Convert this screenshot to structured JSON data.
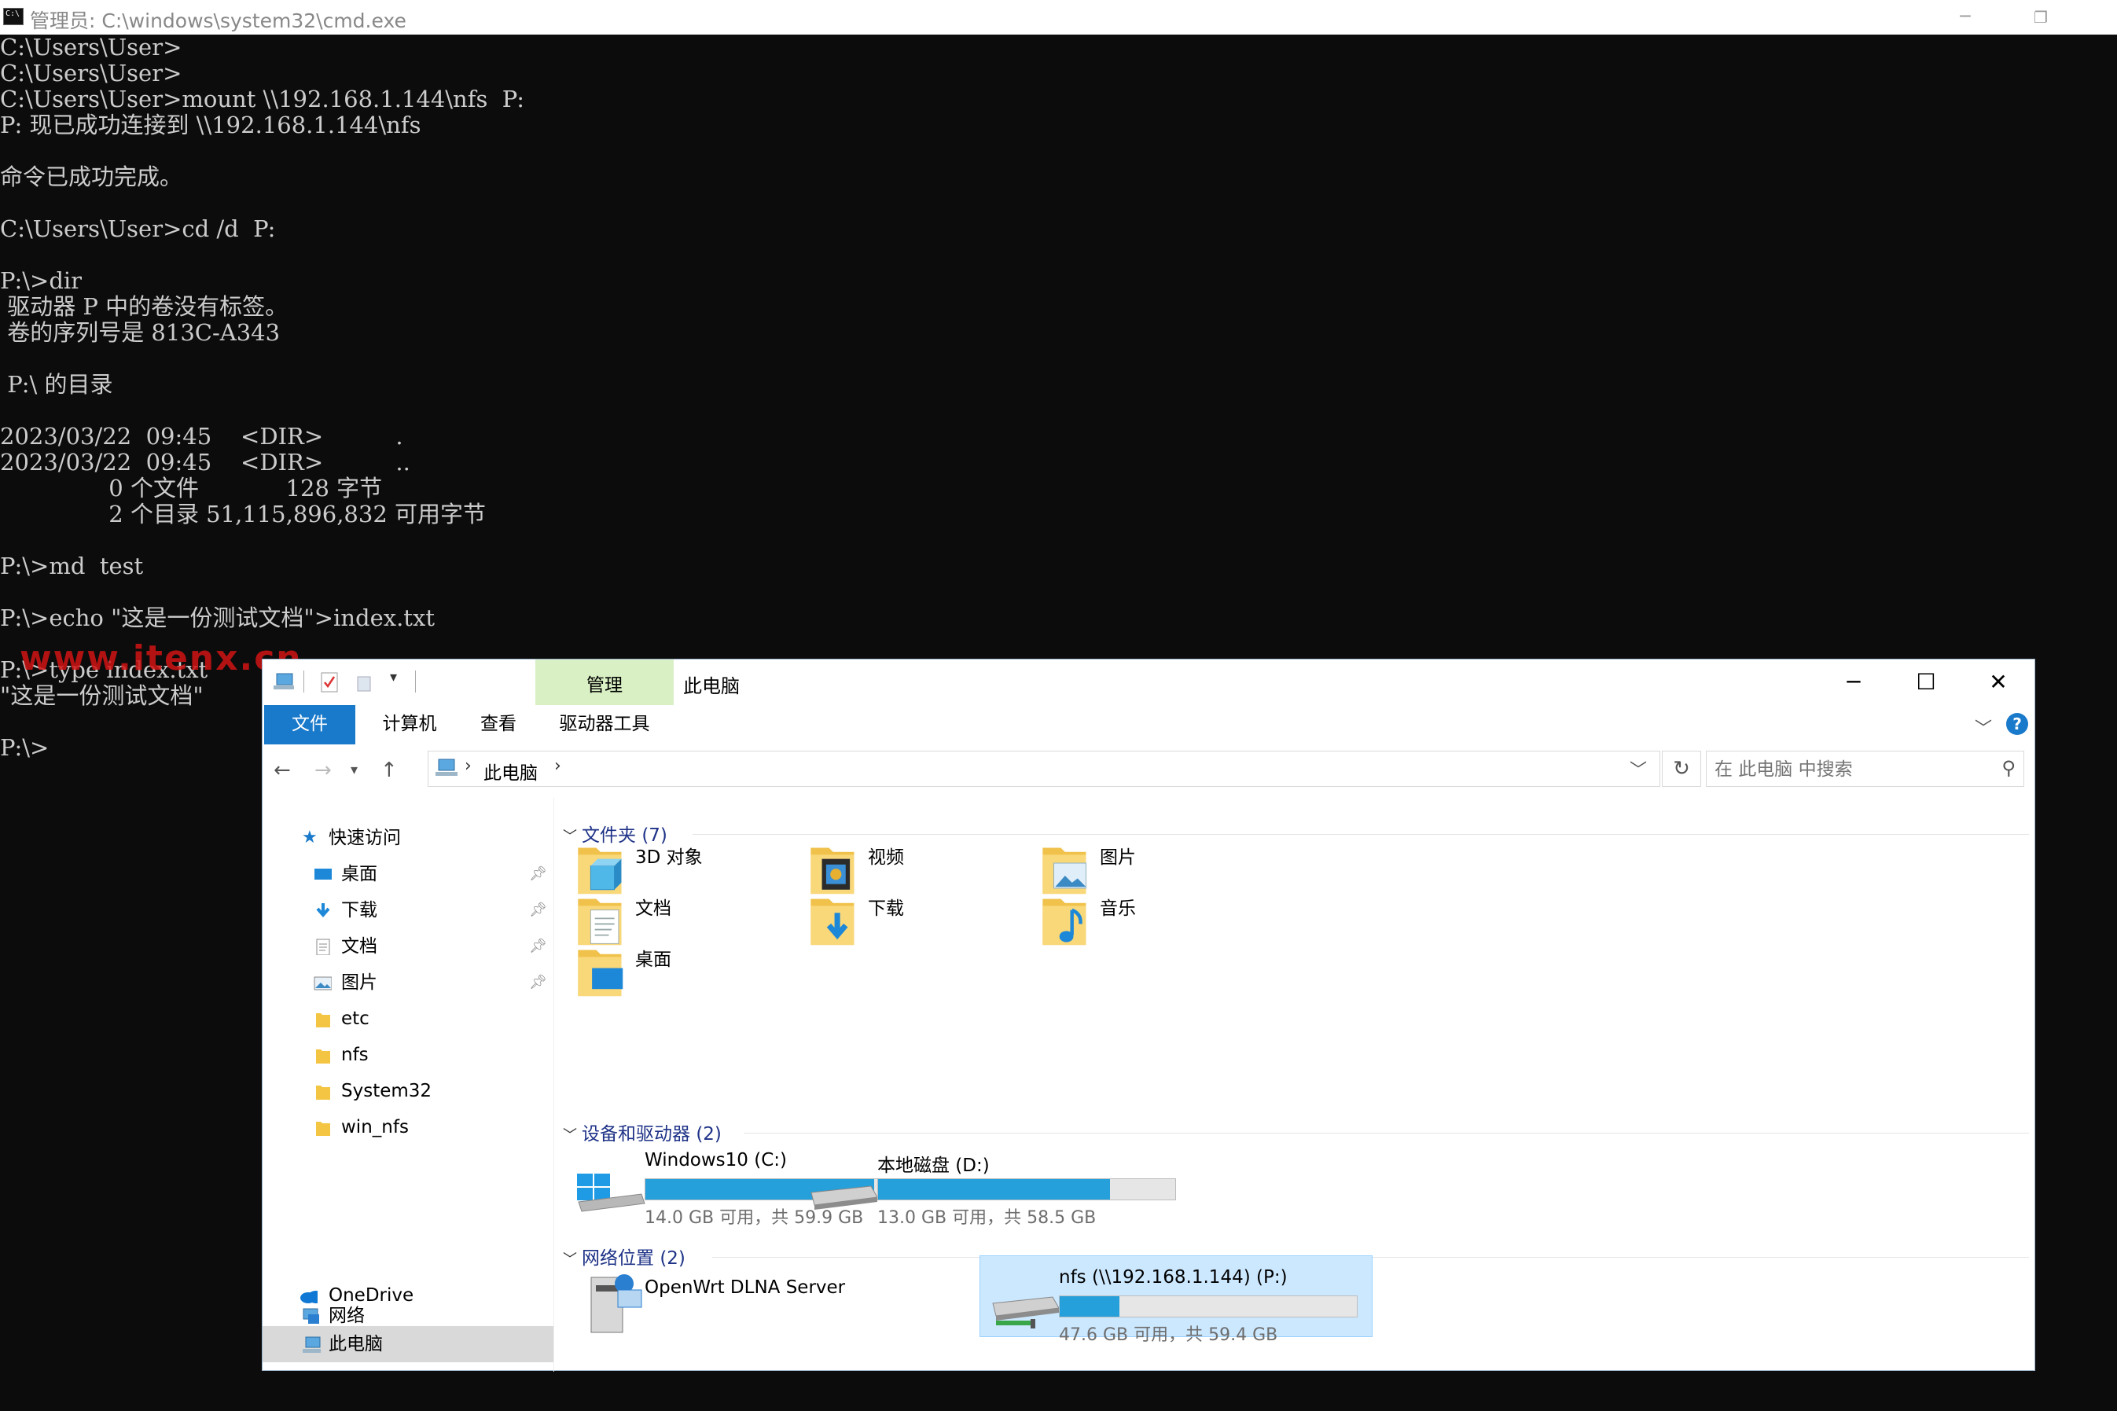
{
  "cmd": {
    "title": "管理员: C:\\windows\\system32\\cmd.exe",
    "lines": [
      "C:\\Users\\User>",
      "C:\\Users\\User>",
      "C:\\Users\\User>mount \\\\192.168.1.144\\nfs  P:",
      "P: 现已成功连接到 \\\\192.168.1.144\\nfs",
      "",
      "命令已成功完成。",
      "",
      "C:\\Users\\User>cd /d  P:",
      "",
      "P:\\>dir",
      " 驱动器 P 中的卷没有标签。",
      " 卷的序列号是 813C-A343",
      "",
      " P:\\ 的目录",
      "",
      "2023/03/22  09:45    <DIR>          .",
      "2023/03/22  09:45    <DIR>          ..",
      "               0 个文件            128 字节",
      "               2 个目录 51,115,896,832 可用字节",
      "",
      "P:\\>md  test",
      "",
      "P:\\>echo \"这是一份测试文档\">index.txt",
      "",
      "P:\\>type index.txt",
      "\"这是一份测试文档\"",
      "",
      "P:\\>"
    ],
    "watermark": "www.itenx.cn"
  },
  "explorer": {
    "context_tab": "管理",
    "title": "此电脑",
    "ribbon_tabs": [
      "文件",
      "计算机",
      "查看",
      "驱动器工具"
    ],
    "breadcrumb": "此电脑",
    "search_placeholder": "在 此电脑 中搜索",
    "sidebar": {
      "quick_access": "快速访问",
      "items": [
        {
          "label": "桌面",
          "pinned": true,
          "icon": "desktop-icon"
        },
        {
          "label": "下载",
          "pinned": true,
          "icon": "download-icon"
        },
        {
          "label": "文档",
          "pinned": true,
          "icon": "document-icon"
        },
        {
          "label": "图片",
          "pinned": true,
          "icon": "pictures-icon"
        },
        {
          "label": "etc",
          "pinned": false,
          "icon": "folder-icon"
        },
        {
          "label": "nfs",
          "pinned": false,
          "icon": "folder-icon"
        },
        {
          "label": "System32",
          "pinned": false,
          "icon": "folder-icon"
        },
        {
          "label": "win_nfs",
          "pinned": false,
          "icon": "folder-icon"
        }
      ],
      "onedrive": "OneDrive",
      "this_pc": "此电脑",
      "network": "网络"
    },
    "groups": {
      "folders": {
        "title": "文件夹",
        "count": "(7)"
      },
      "devices": {
        "title": "设备和驱动器",
        "count": "(2)"
      },
      "network": {
        "title": "网络位置",
        "count": "(2)"
      }
    },
    "folders": [
      "3D 对象",
      "视频",
      "图片",
      "文档",
      "下载",
      "音乐",
      "桌面"
    ],
    "drives": [
      {
        "name": "Windows10 (C:)",
        "info": "14.0 GB 可用，共 59.9 GB",
        "used_fraction": 0.77
      },
      {
        "name": "本地磁盘 (D:)",
        "info": "13.0 GB 可用，共 58.5 GB",
        "used_fraction": 0.78
      }
    ],
    "network_items": [
      {
        "name": "OpenWrt DLNA Server"
      },
      {
        "name": "nfs (\\\\192.168.1.144) (P:)",
        "info": "47.6 GB 可用，共 59.4 GB",
        "used_fraction": 0.2
      }
    ],
    "colors": {
      "accent": "#1979ca",
      "bar": "#26a0da",
      "context_tab": "#d9f0c4"
    }
  }
}
